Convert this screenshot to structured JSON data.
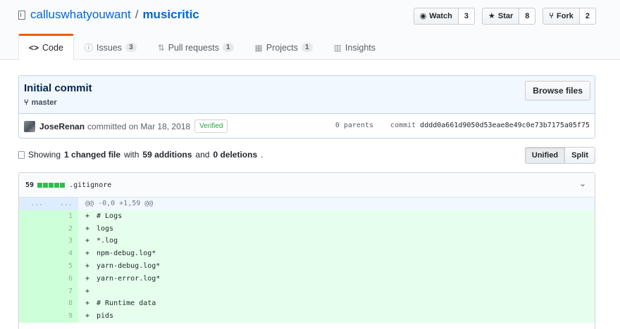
{
  "repo": {
    "owner": "calluswhatyouwant",
    "separator": "/",
    "name": "musicritic"
  },
  "actions": {
    "watch": {
      "label": "Watch",
      "count": "3",
      "icon": "eye-icon"
    },
    "star": {
      "label": "Star",
      "count": "8",
      "icon": "star-icon"
    },
    "fork": {
      "label": "Fork",
      "count": "2",
      "icon": "repo-forked-icon"
    }
  },
  "tabs": [
    {
      "label": "Code",
      "icon": "code-icon",
      "selected": true
    },
    {
      "label": "Issues",
      "count": "3",
      "icon": "issue-opened-icon"
    },
    {
      "label": "Pull requests",
      "count": "1",
      "icon": "git-pull-request-icon"
    },
    {
      "label": "Projects",
      "count": "1",
      "icon": "project-icon"
    },
    {
      "label": "Insights",
      "icon": "graph-icon"
    }
  ],
  "commit": {
    "title": "Initial commit",
    "branch": "master",
    "browse_label": "Browse files",
    "author": "JoseRenan",
    "committed_text": "committed on Mar 18, 2018",
    "verified": "Verified",
    "parents": "0 parents",
    "commit_label": "commit",
    "sha": "dddd0a661d9050d53eae8e49c0e73b7175a05f75"
  },
  "summary": {
    "prefix": "Showing",
    "files": "1 changed file",
    "with": "with",
    "additions": "59 additions",
    "and": "and",
    "deletions": "0 deletions",
    "suffix": "."
  },
  "diff_view": {
    "unified": "Unified",
    "split": "Split",
    "selected": "Unified"
  },
  "file": {
    "additions": "59",
    "name": ".gitignore",
    "hunk": {
      "left": "...",
      "right": "...",
      "header": "@@ -0,0 +1,59 @@"
    },
    "lines": [
      {
        "n": "1",
        "code": "# Logs"
      },
      {
        "n": "2",
        "code": "logs"
      },
      {
        "n": "3",
        "code": "*.log"
      },
      {
        "n": "4",
        "code": "npm-debug.log*"
      },
      {
        "n": "5",
        "code": "yarn-debug.log*"
      },
      {
        "n": "6",
        "code": "yarn-error.log*"
      },
      {
        "n": "7",
        "code": ""
      },
      {
        "n": "8",
        "code": "# Runtime data"
      },
      {
        "n": "9",
        "code": "pids"
      }
    ]
  },
  "colors": {
    "link": "#0366d6",
    "tab_accent": "#e36209",
    "addition_bg": "#e6ffed",
    "addition_num_bg": "#cdffd8",
    "verified": "#28a745"
  }
}
